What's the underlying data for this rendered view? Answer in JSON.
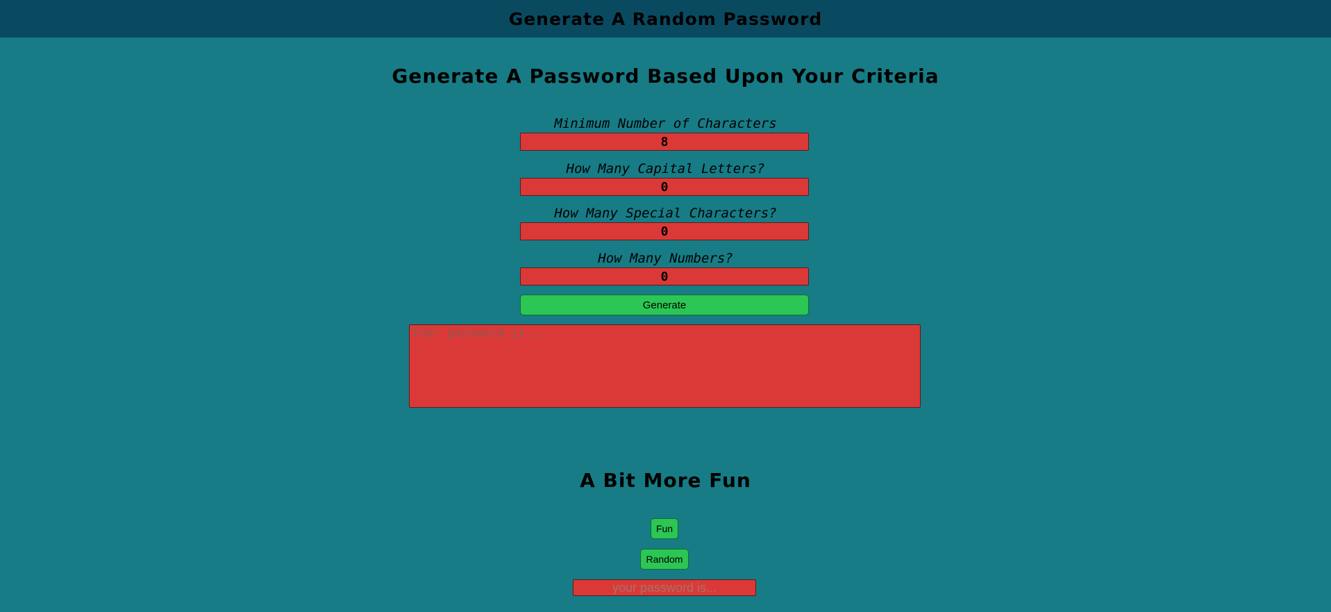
{
  "header": {
    "title": "Generate A Random Password"
  },
  "main": {
    "heading": "Generate A Password Based Upon Your Criteria",
    "fields": [
      {
        "label": "Minimum Number of Characters",
        "value": "8"
      },
      {
        "label": "How Many Capital Letters?",
        "value": "0"
      },
      {
        "label": "How Many Special Characters?",
        "value": "0"
      },
      {
        "label": "How Many Numbers?",
        "value": "0"
      }
    ],
    "generate_label": "Generate",
    "result_placeholder": "Your password is..."
  },
  "fun": {
    "heading": "A Bit More Fun",
    "fun_label": "Fun",
    "random_label": "Random",
    "output_placeholder": "your password is..."
  },
  "colors": {
    "background": "#177c86",
    "header_bar": "#0a4a61",
    "input_red": "#db3937",
    "button_green": "#2cc654"
  }
}
